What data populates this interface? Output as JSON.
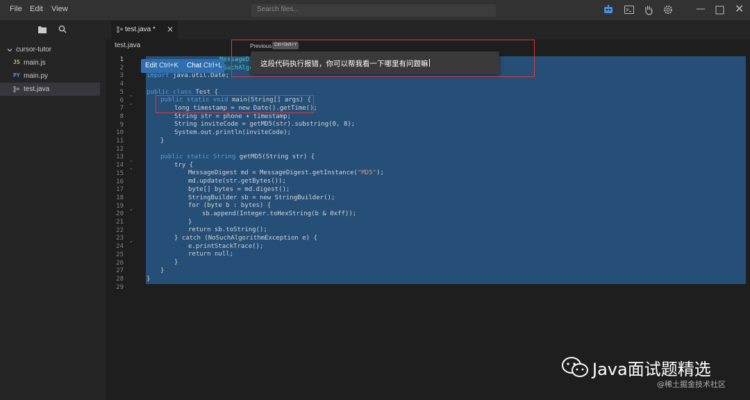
{
  "menu": {
    "file": "File",
    "edit": "Edit",
    "view": "View"
  },
  "search": {
    "placeholder": "Search files..."
  },
  "explorer": {
    "root": "cursor-tutor",
    "files": [
      {
        "badge": "JS",
        "badge_color": "#cbcb41",
        "name": "main.js"
      },
      {
        "badge": "PY",
        "badge_color": "#519aba",
        "name": "main.py"
      },
      {
        "badge": "",
        "badge_color": "#a0a0a0",
        "name": "test.java"
      }
    ]
  },
  "tab": {
    "label": "test.java *",
    "close": "×"
  },
  "breadcrumb": "test.java",
  "inline_widget": {
    "edit": "Edit",
    "edit_key": "Ctrl+K",
    "chat": "Chat",
    "chat_key": "Ctrl+L"
  },
  "popup": {
    "label": "Previous",
    "shortcut": "Ctrl+Shift+Y",
    "text": "这段代码执行报错，你可以帮我看一下哪里有问题嘛"
  },
  "code_visible_fragments": {
    "line1": "MessageDi",
    "line2": "oSuchAlgo"
  },
  "code": {
    "line_numbers": [
      "1",
      "2",
      "3",
      "4",
      "5",
      "6",
      "7",
      "8",
      "9",
      "10",
      "11",
      "12",
      "13",
      "14",
      "15",
      "16",
      "17",
      "18",
      "19",
      "20",
      "21",
      "22",
      "23",
      "24",
      "25",
      "26",
      "27",
      "28",
      "29"
    ],
    "l3": "import java.util.Date;",
    "l5_kw": "public class",
    "l5_rest": " Test {",
    "l6_kw": "public static void",
    "l6_rest": " main(String[] args) {",
    "l7": "long timestamp = new Date().getTime();",
    "l8": "String str = phone + timestamp;",
    "l9": "String inviteCode = getMD5(str).substring(0, 8);",
    "l10": "System.out.println(inviteCode);",
    "l11": "}",
    "l13_kw": "public static String",
    "l13_rest": " getMD5(String str) {",
    "l14": "try {",
    "l15_a": "MessageDigest md = MessageDigest.getInstance(",
    "l15_s": "\"MD5\"",
    "l15_b": ");",
    "l16": "md.update(str.getBytes());",
    "l17": "byte[] bytes = md.digest();",
    "l18": "StringBuilder sb = new StringBuilder();",
    "l19": "for (byte b : bytes) {",
    "l20": "sb.append(Integer.toHexString(b & 0xff));",
    "l21": "}",
    "l22": "return sb.toString();",
    "l23": "} catch (NoSuchAlgorithmException e) {",
    "l24": "e.printStackTrace();",
    "l25": "return null;",
    "l26": "}",
    "l27": "}",
    "l28": "}"
  },
  "watermark": {
    "title": "Java面试题精选",
    "sub": "@稀土掘金技术社区"
  },
  "colors": {
    "selection": "#264f78",
    "accent": "#2f6fb0",
    "annotation": "#e03a3a"
  }
}
